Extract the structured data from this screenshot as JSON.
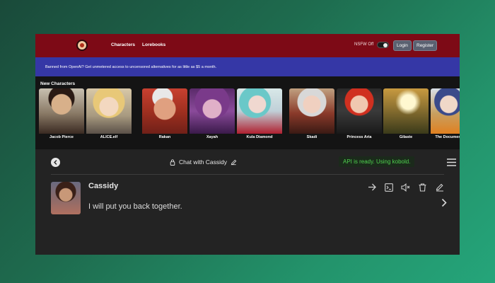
{
  "nav": {
    "logo": "logo-icon",
    "links": [
      "Characters",
      "Lorebooks"
    ],
    "nsfw_label": "NSFW Off",
    "nsfw_enabled": false,
    "login_label": "Login",
    "register_label": "Register"
  },
  "banner": {
    "text": "Banned from OpenAI? Get unmetered access to uncensored alternatives for as little as $5 a month."
  },
  "characters": {
    "title": "New Characters",
    "items": [
      {
        "name": "Jacob Pierce"
      },
      {
        "name": "ALICE.elf"
      },
      {
        "name": "Rakan"
      },
      {
        "name": "Xayah"
      },
      {
        "name": "Kula Diamond"
      },
      {
        "name": "Skadi"
      },
      {
        "name": "Princess Aria"
      },
      {
        "name": "Gilaste"
      },
      {
        "name": "The Documentarian"
      }
    ]
  },
  "chat": {
    "title": "Chat with Cassidy",
    "api_status": "API is ready. Using kobold.",
    "message": {
      "sender": "Cassidy",
      "text": "I will put you back together."
    }
  },
  "colors": {
    "nav_bg": "#7d0a16",
    "banner_bg": "#3537a6",
    "chat_bg": "#232323",
    "api_text": "#4fd14f"
  }
}
